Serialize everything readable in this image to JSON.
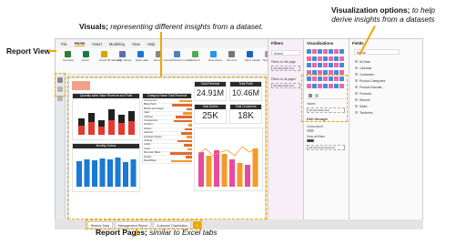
{
  "annotations": {
    "visuals_bold": "Visuals;",
    "visuals_rest": " representing different insights from a dataset.",
    "viz_options_bold": "Visualization options;",
    "viz_options_rest1": " to help",
    "viz_options_rest2": "derive insights from a datasets",
    "report_view": "Report View",
    "report_pages_bold": "Report Pages;",
    "report_pages_rest": " similar to Excel tabs"
  },
  "colors": {
    "accent": "#f2a600",
    "chart_red": "#e43a2f",
    "chart_blue": "#1a7ad4",
    "chart_orange": "#f49a27",
    "chart_pink": "#e94a9c"
  },
  "ribbon_tabs": [
    "File",
    "Home",
    "Insert",
    "Modeling",
    "View",
    "Help"
  ],
  "ribbon_buttons": [
    "Get data",
    "Excel",
    "Power BI datasets",
    "SQL Server",
    "Enter data",
    "Recent sources",
    "Transform data",
    "Refresh",
    "New visual",
    "Text box",
    "More visuals",
    "New measure",
    "Quick measure",
    "Publish"
  ],
  "kpis": [
    {
      "title": "Total Revenue",
      "value": "24.91M"
    },
    {
      "title": "Total Profit",
      "value": "10.46M"
    },
    {
      "title": "Total Orders",
      "value": "25K"
    },
    {
      "title": "Total Customers",
      "value": "18K"
    }
  ],
  "card_titles": {
    "stacked": "Quantity sales Value Revenue and Profit",
    "table": "Category Name Total Revenue",
    "column": "Monthly Orders"
  },
  "table_rows": [
    "Accessories",
    "Bikes Parts",
    "Bottles and Cages",
    "Caps",
    "Clothing",
    "Components",
    "Fenders",
    "Gloves",
    "Helmets",
    "Hydration Packs",
    "Jerseys",
    "Lights",
    "Locks",
    "Mountain Bikes",
    "Pedals",
    "Road Bikes"
  ],
  "filters": {
    "title": "Filters",
    "search": "Search",
    "on_this_page": "Filters on this page",
    "add_fields": "Add data fields here",
    "on_all_pages": "Filters on all pages",
    "add_fields_2": "Add data fields here"
  },
  "visualizations": {
    "title": "Visualizations",
    "values_label": "Values",
    "add_fields": "Add data fields here",
    "drill_through": "Drill through",
    "cross_report": "Cross-report",
    "keep_filters": "Keep all filters",
    "add_drill": "Add drill-through fields here"
  },
  "fields": {
    "title": "Fields",
    "search": "Search",
    "items": [
      "All Data",
      "Calendar",
      "Customers",
      "Product Categories",
      "Product Subcate...",
      "Products",
      "Returns",
      "Sales",
      "Territories"
    ]
  },
  "page_tabs": [
    "Historic Data",
    "Management Report",
    "Customer Distribution"
  ],
  "add_page_symbol": "+"
}
